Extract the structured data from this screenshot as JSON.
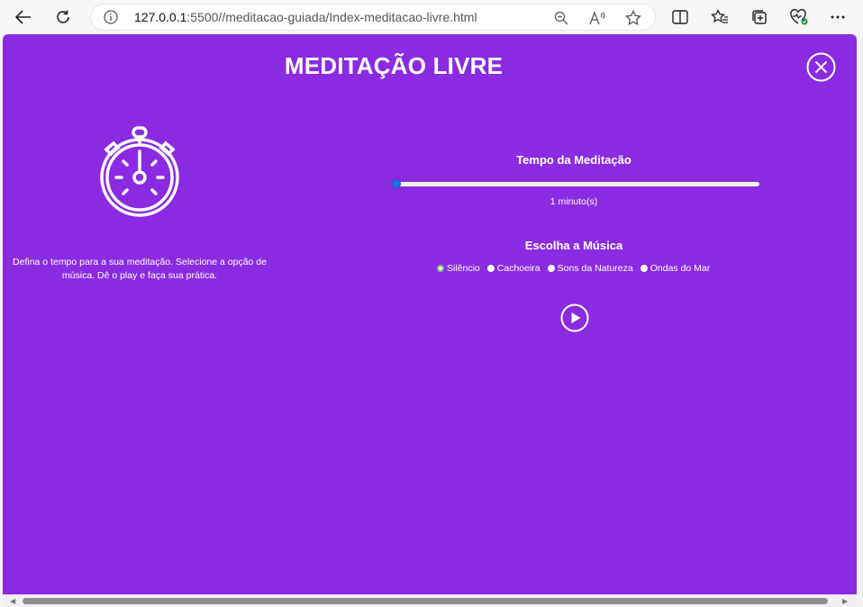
{
  "browser": {
    "url_host": "127.0.0.1",
    "url_rest": ":5500//meditacao-guiada/Index-meditacao-livre.html",
    "icons": [
      "back-icon",
      "refresh-icon",
      "info-icon",
      "zoom-icon",
      "read-aloud-icon",
      "favorite-icon",
      "split-screen-icon",
      "favorites-icon",
      "collections-icon",
      "health-icon",
      "more-icon"
    ]
  },
  "page": {
    "title": "MEDITAÇÃO LIVRE",
    "description": "Defina o tempo para a sua meditação. Selecione a opção de música. Dê o play e faça sua prática.",
    "tempo_title": "Tempo da Meditação",
    "slider_value_fraction": 0,
    "minutes_label": "1 minuto(s)",
    "music_title": "Escolha a Música",
    "music_options": [
      {
        "label": "Silêncio",
        "checked": true
      },
      {
        "label": "Cachoeira",
        "checked": false
      },
      {
        "label": "Sons da Natureza",
        "checked": false
      },
      {
        "label": "Ondas do Mar",
        "checked": false
      }
    ]
  },
  "colors": {
    "background": "#8a2be2",
    "slider_thumb": "#1a73e8"
  }
}
